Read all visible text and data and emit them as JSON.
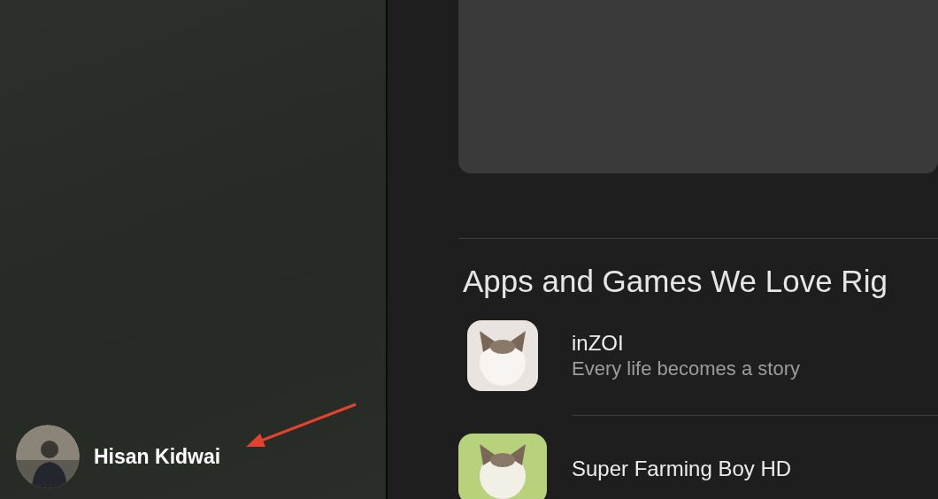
{
  "sidebar": {
    "user": {
      "name": "Hisan Kidwai"
    }
  },
  "section": {
    "title": "Apps and Games We Love Rig",
    "apps": [
      {
        "name": "inZOI",
        "subtitle": "Every life becomes a story"
      },
      {
        "name": "Super Farming Boy HD"
      }
    ]
  }
}
